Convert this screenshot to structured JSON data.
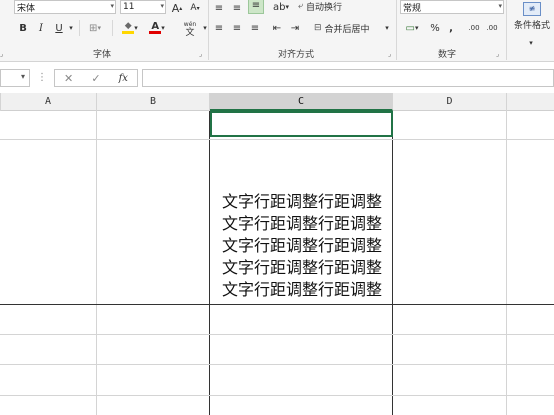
{
  "ribbon": {
    "font": {
      "name": "宋体",
      "size": "11",
      "grow_label": "A",
      "shrink_label": "A",
      "bold": "B",
      "italic": "I",
      "underline": "U",
      "border_glyph": "⊞",
      "fill_glyph": "◆",
      "font_color_label": "A",
      "phonetic_label": "wén",
      "phonetic_char": "文",
      "group_label": "字体"
    },
    "alignment": {
      "wrap_text": "自动换行",
      "merge_center": "合并后居中",
      "group_label": "对齐方式"
    },
    "number": {
      "format": "常规",
      "percent": "%",
      "comma": ",",
      "inc_decimal": ".00",
      "dec_decimal": ".00",
      "group_label": "数字"
    },
    "styles": {
      "conditional_format": "条件格式"
    },
    "colors": {
      "accent_green": "#217346",
      "fill_yellow": "#ffd700",
      "font_red": "#e00000"
    }
  },
  "formula_bar": {
    "cancel_glyph": "✕",
    "enter_glyph": "✓",
    "fx_label": "fx",
    "formula": ""
  },
  "grid": {
    "columns": [
      "A",
      "B",
      "C",
      "D"
    ],
    "selected_column": "C",
    "cell_c2_text": "文字行距调整行距调整文字行距调整行距调整文字行距调整行距调整文字行距调整行距调整文字行距调整行距调整"
  }
}
